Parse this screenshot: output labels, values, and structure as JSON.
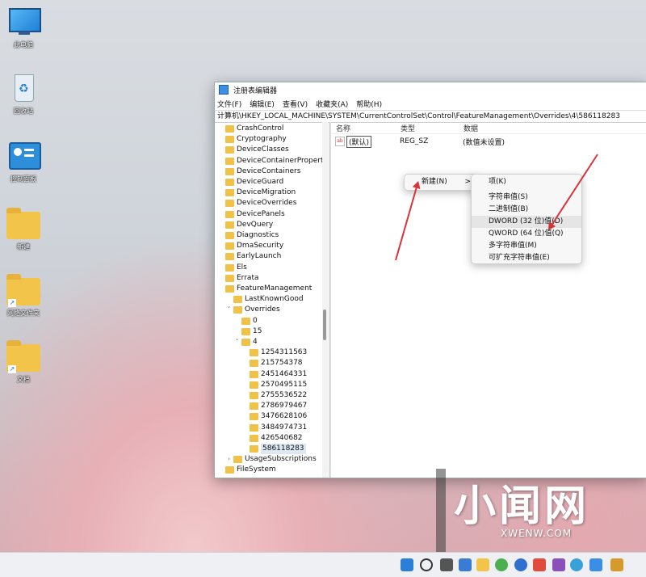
{
  "desktop": {
    "icons": [
      {
        "label": "此电脑",
        "icon": "monitor-icon"
      },
      {
        "label": "回收站",
        "icon": "recycle-bin-icon"
      },
      {
        "label": "控制面板",
        "icon": "control-panel-icon"
      },
      {
        "label": "新建",
        "icon": "folder-icon"
      },
      {
        "label": "网络文件夹",
        "icon": "folder-shortcut-icon"
      },
      {
        "label": "文档",
        "icon": "folder-shortcut-icon"
      }
    ]
  },
  "window": {
    "title": "注册表编辑器",
    "menu": [
      "文件(F)",
      "编辑(E)",
      "查看(V)",
      "收藏夹(A)",
      "帮助(H)"
    ],
    "address": "计算机\\HKEY_LOCAL_MACHINE\\SYSTEM\\CurrentControlSet\\Control\\FeatureManagement\\Overrides\\4\\586118283",
    "tree": [
      {
        "label": "CrashControl",
        "level": 0
      },
      {
        "label": "Cryptography",
        "level": 0
      },
      {
        "label": "DeviceClasses",
        "level": 0
      },
      {
        "label": "DeviceContainerPropertyUpda",
        "level": 0
      },
      {
        "label": "DeviceContainers",
        "level": 0
      },
      {
        "label": "DeviceGuard",
        "level": 0
      },
      {
        "label": "DeviceMigration",
        "level": 0
      },
      {
        "label": "DeviceOverrides",
        "level": 0
      },
      {
        "label": "DevicePanels",
        "level": 0
      },
      {
        "label": "DevQuery",
        "level": 0
      },
      {
        "label": "Diagnostics",
        "level": 0
      },
      {
        "label": "DmaSecurity",
        "level": 0
      },
      {
        "label": "EarlyLaunch",
        "level": 0
      },
      {
        "label": "Els",
        "level": 0
      },
      {
        "label": "Errata",
        "level": 0
      },
      {
        "label": "FeatureManagement",
        "level": 0
      },
      {
        "label": "LastKnownGood",
        "level": 1
      },
      {
        "label": "Overrides",
        "level": 1,
        "expanded": true
      },
      {
        "label": "0",
        "level": 2
      },
      {
        "label": "15",
        "level": 2
      },
      {
        "label": "4",
        "level": 2,
        "expanded": true
      },
      {
        "label": "1254311563",
        "level": 3
      },
      {
        "label": "215754378",
        "level": 3
      },
      {
        "label": "2451464331",
        "level": 3
      },
      {
        "label": "2570495115",
        "level": 3
      },
      {
        "label": "2755536522",
        "level": 3
      },
      {
        "label": "2786979467",
        "level": 3
      },
      {
        "label": "3476628106",
        "level": 3
      },
      {
        "label": "3484974731",
        "level": 3
      },
      {
        "label": "426540682",
        "level": 3
      },
      {
        "label": "586118283",
        "level": 3,
        "selected": true
      },
      {
        "label": "UsageSubscriptions",
        "level": 1,
        "collapsed": true
      },
      {
        "label": "FileSystem",
        "level": 0
      }
    ],
    "columns": {
      "name": "名称",
      "type": "类型",
      "data": "数据"
    },
    "values": [
      {
        "name": "(默认)",
        "type": "REG_SZ",
        "data": "(数值未设置)"
      }
    ]
  },
  "context_menu": {
    "new_label": "新建(N)",
    "submenu_arrow": ">",
    "submenu": [
      "项(K)",
      "字符串值(S)",
      "二进制值(B)",
      "DWORD (32 位)值(D)",
      "QWORD (64 位)值(Q)",
      "多字符串值(M)",
      "可扩充字符串值(E)"
    ]
  },
  "watermark": {
    "big": "小闻网",
    "small": "XWENW.COM"
  },
  "colors": {
    "arrow": "#d8343a",
    "folder": "#f0c24a",
    "selection": "#dde8f3"
  }
}
